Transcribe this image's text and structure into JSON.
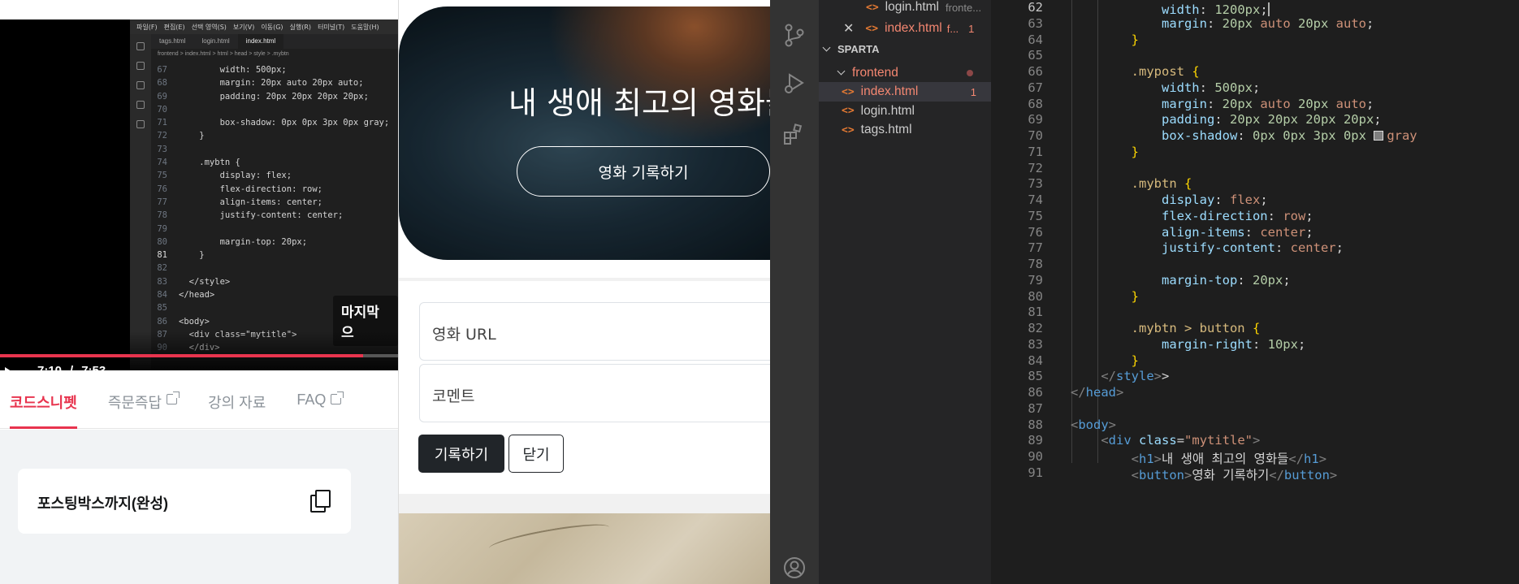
{
  "lecture": {
    "video": {
      "menu": [
        "파일(F)",
        "편집(E)",
        "선택 영역(S)",
        "보기(V)",
        "이동(G)",
        "실행(R)",
        "터미널(T)",
        "도움말(H)"
      ],
      "tabs": [
        "tags.html",
        "login.html",
        "index.html"
      ],
      "breadcrumb": "frontend > index.html > html > head > style > .mybtn",
      "code_lines": [
        {
          "n": "67",
          "t": "        width: 500px;"
        },
        {
          "n": "68",
          "t": "        margin: 20px auto 20px auto;"
        },
        {
          "n": "69",
          "t": "        padding: 20px 20px 20px 20px;"
        },
        {
          "n": "70",
          "t": ""
        },
        {
          "n": "71",
          "t": "        box-shadow: 0px 0px 3px 0px gray;"
        },
        {
          "n": "72",
          "t": "    }"
        },
        {
          "n": "73",
          "t": ""
        },
        {
          "n": "74",
          "t": "    .mybtn {"
        },
        {
          "n": "75",
          "t": "        display: flex;"
        },
        {
          "n": "76",
          "t": "        flex-direction: row;"
        },
        {
          "n": "77",
          "t": "        align-items: center;"
        },
        {
          "n": "78",
          "t": "        justify-content: center;"
        },
        {
          "n": "79",
          "t": ""
        },
        {
          "n": "80",
          "t": "        margin-top: 20px;"
        },
        {
          "n": "81",
          "t": "    }"
        },
        {
          "n": "82",
          "t": ""
        },
        {
          "n": "83",
          "t": "  </style>"
        },
        {
          "n": "84",
          "t": "</head>"
        },
        {
          "n": "85",
          "t": ""
        },
        {
          "n": "86",
          "t": "<body>"
        },
        {
          "n": "87",
          "t": "  <div class=\"mytitle\">"
        },
        {
          "n": "90",
          "t": "  </div>"
        }
      ],
      "caption": "마지막으",
      "current_time": "7:10",
      "separator": "/",
      "duration": "7:53",
      "progress": 0.913
    },
    "tabs": [
      {
        "label": "코드스니펫",
        "active": true,
        "external": false
      },
      {
        "label": "즉문즉답",
        "active": false,
        "external": true
      },
      {
        "label": "강의 자료",
        "active": false,
        "external": false
      },
      {
        "label": "FAQ",
        "active": false,
        "external": true
      }
    ],
    "snippet_title": "포스팅박스까지(완성)"
  },
  "preview": {
    "hero_title": "내 생애 최고의 영화들",
    "hero_button": "영화 기록하기",
    "url_placeholder": "영화 URL",
    "comment_placeholder": "코멘트",
    "save_button": "기록하기",
    "close_button": "닫기"
  },
  "vscode": {
    "open_editors": [
      {
        "name": "login.html",
        "path": "fronte..."
      },
      {
        "name": "index.html",
        "path": "f...",
        "problems": "1"
      }
    ],
    "workspace": "SPARTA",
    "folder": "frontend",
    "files": [
      {
        "name": "index.html",
        "problems": "1"
      },
      {
        "name": "login.html",
        "problems": ""
      },
      {
        "name": "tags.html",
        "problems": ""
      }
    ],
    "code": [
      {
        "n": "62",
        "html": "            <span class=t-prop>width</span>: <span class=t-num>1200px</span>;<span class=cursor></span>"
      },
      {
        "n": "63",
        "html": "            <span class=t-prop>margin</span>: <span class=t-num>20px</span> <span class=t-val>auto</span> <span class=t-num>20px</span> <span class=t-val>auto</span>;"
      },
      {
        "n": "64",
        "html": "        <span class=t-br>}</span>"
      },
      {
        "n": "65",
        "html": ""
      },
      {
        "n": "66",
        "html": "        <span class=t-sel>.mypost</span> <span class=t-br>{</span>"
      },
      {
        "n": "67",
        "html": "            <span class=t-prop>width</span>: <span class=t-num>500px</span>;"
      },
      {
        "n": "68",
        "html": "            <span class=t-prop>margin</span>: <span class=t-num>20px</span> <span class=t-val>auto</span> <span class=t-num>20px</span> <span class=t-val>auto</span>;"
      },
      {
        "n": "69",
        "html": "            <span class=t-prop>padding</span>: <span class=t-num>20px 20px 20px 20px</span>;"
      },
      {
        "n": "70",
        "html": "            <span class=t-prop>box-shadow</span>: <span class=t-num>0px 0px 3px 0px</span> <span class=swatch></span><span class=t-val>gray</span>"
      },
      {
        "n": "71",
        "html": "        <span class=t-br>}</span>"
      },
      {
        "n": "72",
        "html": ""
      },
      {
        "n": "73",
        "html": "        <span class=t-sel>.mybtn</span> <span class=t-br>{</span>"
      },
      {
        "n": "74",
        "html": "            <span class=t-prop>display</span>: <span class=t-val>flex</span>;"
      },
      {
        "n": "75",
        "html": "            <span class=t-prop>flex-direction</span>: <span class=t-val>row</span>;"
      },
      {
        "n": "76",
        "html": "            <span class=t-prop>align-items</span>: <span class=t-val>center</span>;"
      },
      {
        "n": "77",
        "html": "            <span class=t-prop>justify-content</span>: <span class=t-val>center</span>;"
      },
      {
        "n": "78",
        "html": ""
      },
      {
        "n": "79",
        "html": "            <span class=t-prop>margin-top</span>: <span class=t-num>20px</span>;"
      },
      {
        "n": "80",
        "html": "        <span class=t-br>}</span>"
      },
      {
        "n": "81",
        "html": ""
      },
      {
        "n": "82",
        "html": "        <span class=t-sel>.mybtn &gt; button</span> <span class=t-br>{</span>"
      },
      {
        "n": "83",
        "html": "            <span class=t-prop>margin-right</span>: <span class=t-num>10px</span>;"
      },
      {
        "n": "84",
        "html": "        <span class=t-br>}</span>"
      },
      {
        "n": "85",
        "html": "    <span class=t-ang>&lt;/</span><span class=t-tag>style</span><span class=t-ang>&gt;</span>&gt;"
      },
      {
        "n": "86",
        "html": "<span class=t-ang>&lt;/</span><span class=t-tag>head</span><span class=t-ang>&gt;</span>"
      },
      {
        "n": "87",
        "html": ""
      },
      {
        "n": "88",
        "html": "<span class=t-ang>&lt;</span><span class=t-tag>body</span><span class=t-ang>&gt;</span>"
      },
      {
        "n": "89",
        "html": "    <span class=t-ang>&lt;</span><span class=t-tag>div</span> <span class=t-attr>class</span>=<span class=t-str>\"mytitle\"</span><span class=t-ang>&gt;</span>"
      },
      {
        "n": "90",
        "html": "        <span class=t-ang>&lt;</span><span class=t-tag>h1</span><span class=t-ang>&gt;</span>내 생애 최고의 영화들<span class=t-ang>&lt;/</span><span class=t-tag>h1</span><span class=t-ang>&gt;</span>"
      },
      {
        "n": "91",
        "html": "        <span class=t-ang>&lt;</span><span class=t-tag>button</span><span class=t-ang>&gt;</span>영화 기록하기<span class=t-ang>&lt;/</span><span class=t-tag>button</span><span class=t-ang>&gt;</span>"
      }
    ]
  }
}
